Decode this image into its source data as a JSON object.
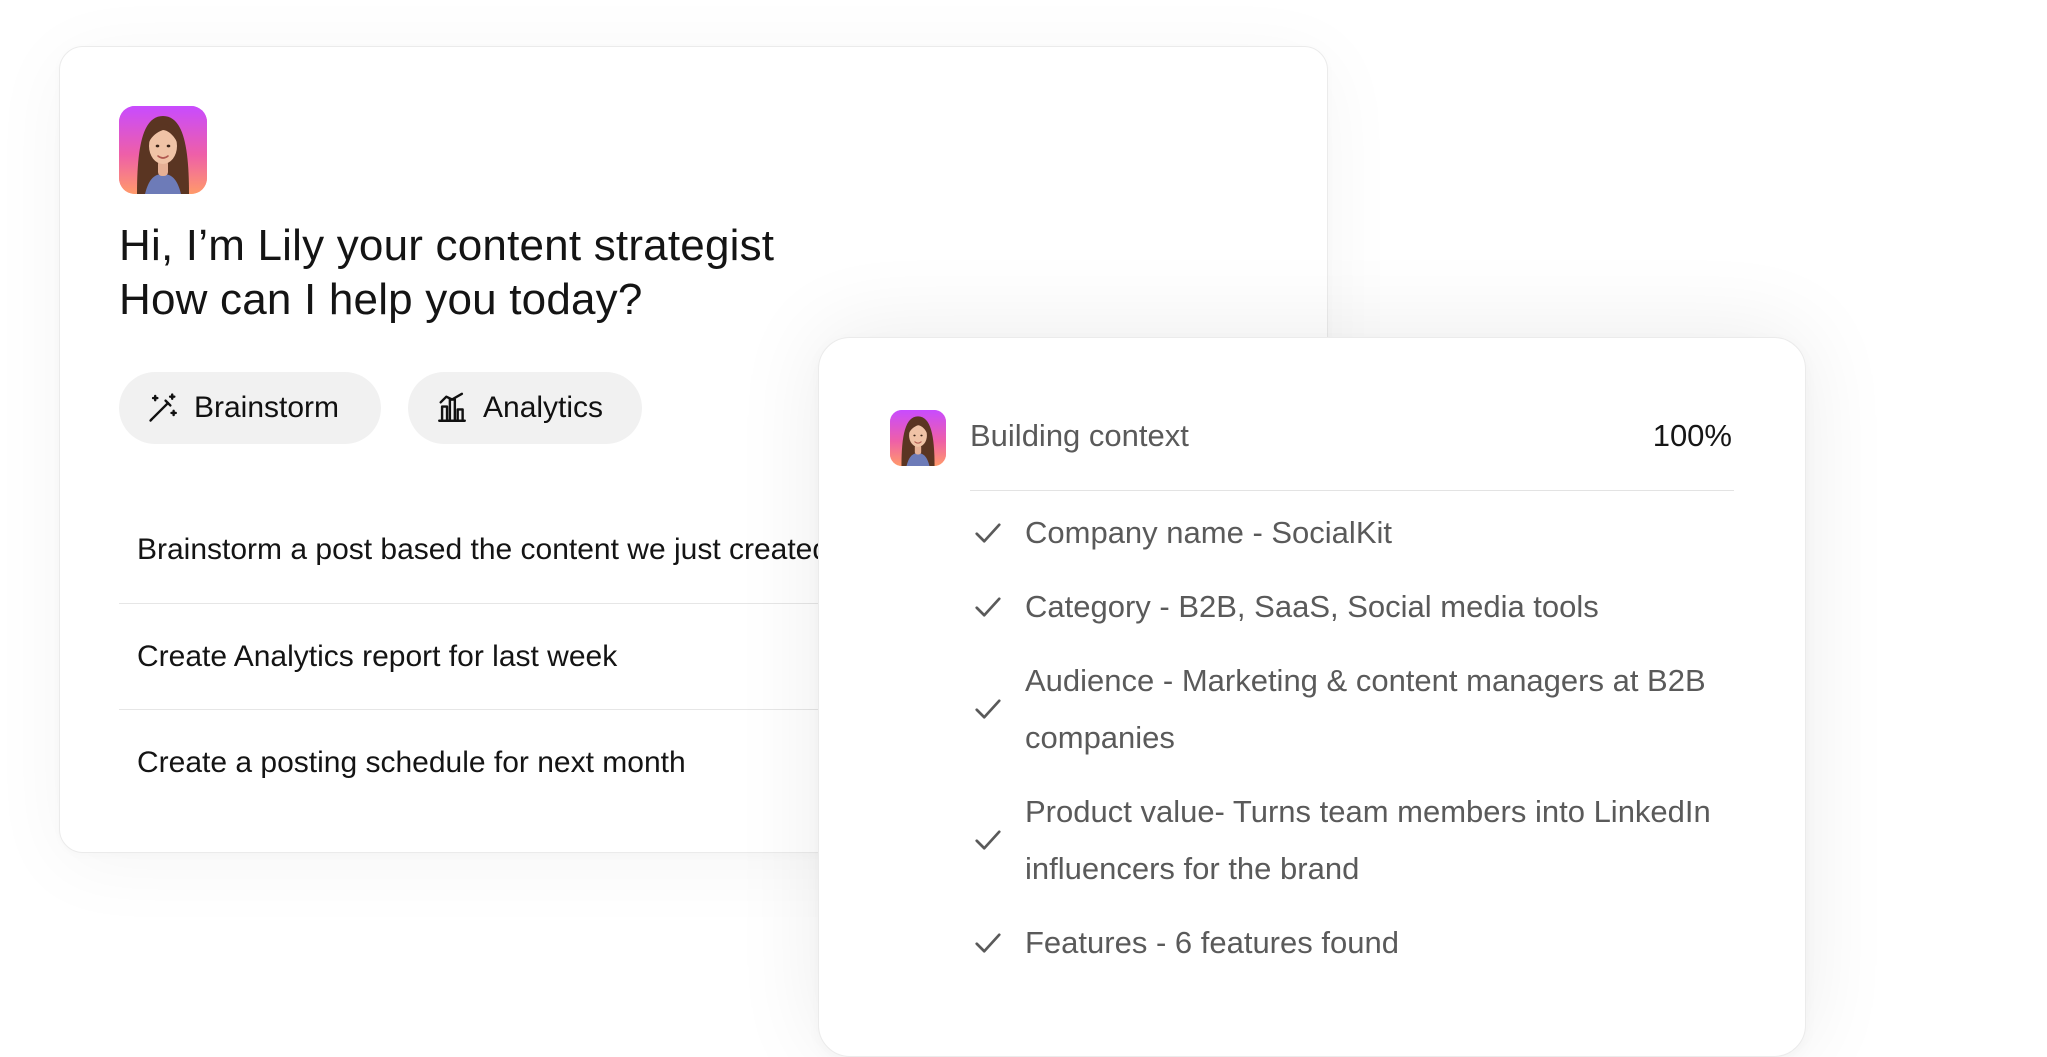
{
  "assistant": {
    "greeting_line1": "Hi, I’m Lily your content strategist",
    "greeting_line2": "How can I help you today?"
  },
  "chips": [
    {
      "label": "Brainstorm",
      "icon": "magic-wand-icon"
    },
    {
      "label": "Analytics",
      "icon": "analytics-chart-icon"
    }
  ],
  "suggestions": [
    "Brainstorm a post based the content we just created",
    "Create Analytics report for last week",
    "Create a posting schedule for next month"
  ],
  "context": {
    "title": "Building context",
    "percent": "100%",
    "items": [
      "Company name - SocialKit",
      "Category - B2B, SaaS, Social media tools",
      "Audience - Marketing & content managers at B2B companies",
      "Product value- Turns team members into LinkedIn influencers for the brand",
      "Features - 6 features found"
    ]
  },
  "colors": {
    "avatar_gradient": [
      "#c84bff",
      "#ee5fa8",
      "#ff9a6a"
    ],
    "chip_bg": "#f1f1f1",
    "muted_text": "#5a5a5a"
  }
}
